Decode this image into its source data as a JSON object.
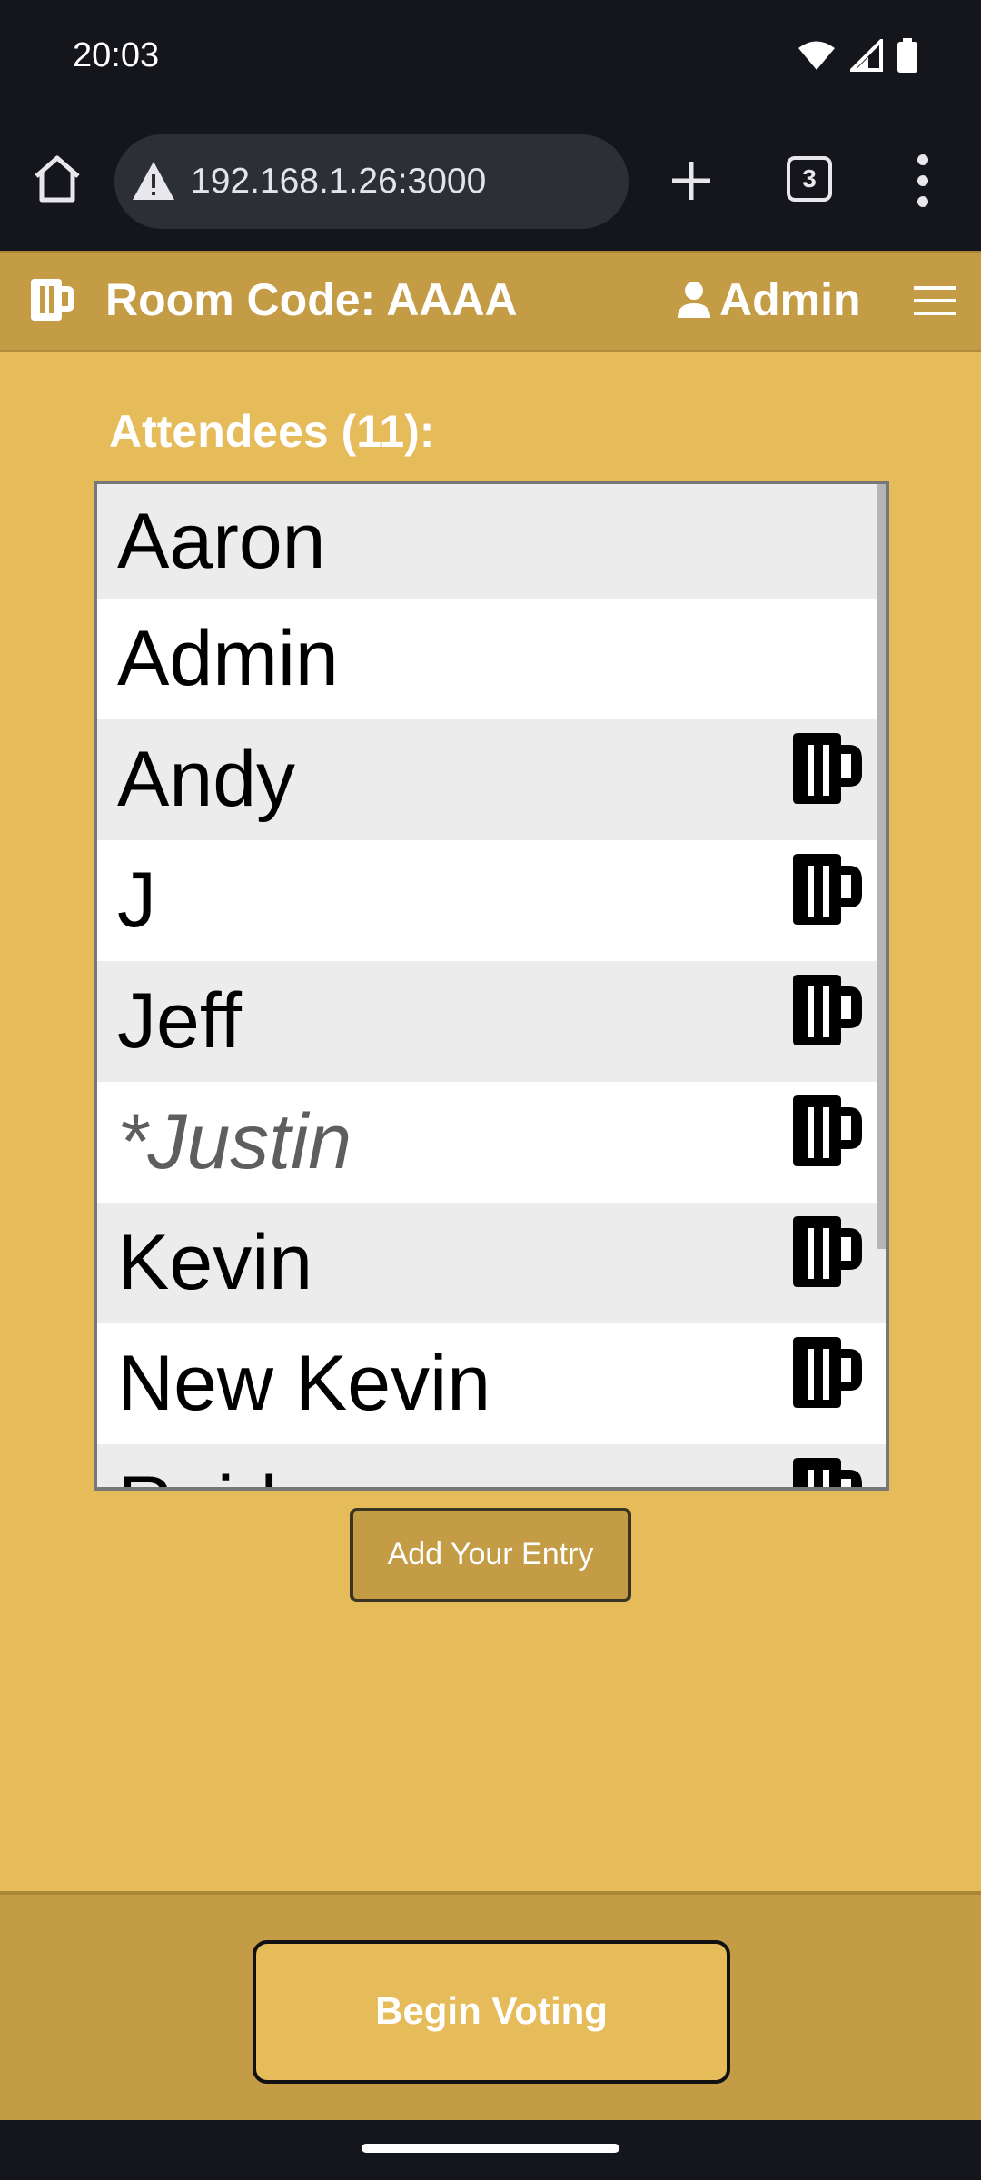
{
  "status": {
    "time": "20:03",
    "icons": [
      "wifi-icon",
      "signal-icon",
      "battery-icon"
    ]
  },
  "browser": {
    "url": "192.168.1.26:3000",
    "tab_count": "3",
    "icons": [
      "home-icon",
      "warning-icon",
      "plus-icon",
      "more-vert-icon"
    ]
  },
  "header": {
    "room_code": "Room Code: AAAA",
    "user_name": "Admin",
    "icons": [
      "beer-mug-icon",
      "person-icon",
      "hamburger-menu-icon"
    ]
  },
  "attendees": {
    "title": "Attendees (11):",
    "items": [
      {
        "name": "Aaron",
        "beer": false,
        "pending": false
      },
      {
        "name": "Admin",
        "beer": false,
        "pending": false
      },
      {
        "name": "Andy",
        "beer": true,
        "pending": false
      },
      {
        "name": "J",
        "beer": true,
        "pending": false
      },
      {
        "name": "Jeff",
        "beer": true,
        "pending": false
      },
      {
        "name": "*Justin",
        "beer": true,
        "pending": true
      },
      {
        "name": "Kevin",
        "beer": true,
        "pending": false
      },
      {
        "name": "New Kevin",
        "beer": true,
        "pending": false
      },
      {
        "name": "Reid",
        "beer": true,
        "pending": false
      }
    ]
  },
  "actions": {
    "add_entry": "Add Your Entry",
    "begin_voting": "Begin Voting"
  },
  "colors": {
    "app_bg": "#e6bb59",
    "header_bg": "#c39c45",
    "list_alt_row": "#ececec"
  }
}
